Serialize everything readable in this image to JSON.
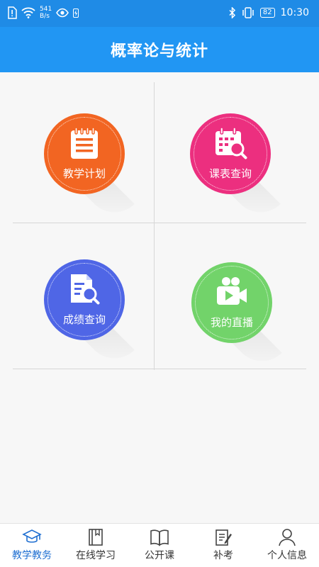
{
  "status_bar": {
    "net_speed_value": "541",
    "net_speed_unit": "B/s",
    "battery": "82",
    "time": "10:30"
  },
  "header": {
    "title": "概率论与统计"
  },
  "tiles": [
    {
      "label": "教学计划",
      "icon": "notepad-icon",
      "color": "#f26522"
    },
    {
      "label": "课表查询",
      "icon": "calendar-search-icon",
      "color": "#ec2f7f"
    },
    {
      "label": "成绩查询",
      "icon": "document-search-icon",
      "color": "#4f66e6"
    },
    {
      "label": "我的直播",
      "icon": "video-camera-icon",
      "color": "#72d36a"
    }
  ],
  "bottom_nav": {
    "active_color": "#1f6fd1",
    "items": [
      {
        "label": "教学教务",
        "icon": "graduation-cap-icon"
      },
      {
        "label": "在线学习",
        "icon": "book-icon"
      },
      {
        "label": "公开课",
        "icon": "open-book-icon"
      },
      {
        "label": "补考",
        "icon": "pen-paper-icon"
      },
      {
        "label": "个人信息",
        "icon": "person-icon"
      }
    ]
  }
}
